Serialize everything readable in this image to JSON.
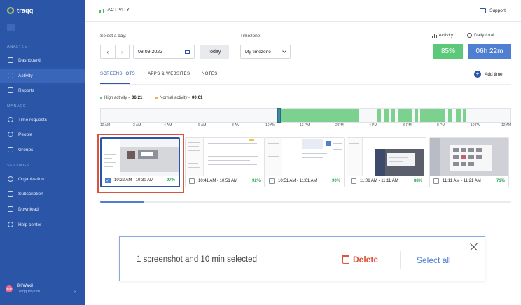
{
  "app": {
    "name": "traqq"
  },
  "sidebar": {
    "sections": [
      {
        "label": "ANALYZE",
        "items": [
          {
            "label": "Dashboard",
            "icon": "monitor-icon"
          },
          {
            "label": "Activity",
            "icon": "home-icon",
            "active": true
          },
          {
            "label": "Reports",
            "icon": "folder-icon"
          }
        ]
      },
      {
        "label": "MANAGE",
        "items": [
          {
            "label": "Time requests",
            "icon": "clock-icon"
          },
          {
            "label": "People",
            "icon": "people-icon"
          },
          {
            "label": "Groups",
            "icon": "group-icon"
          }
        ]
      },
      {
        "label": "SETTINGS",
        "items": [
          {
            "label": "Organization",
            "icon": "gear-icon"
          },
          {
            "label": "Subscription",
            "icon": "star-icon"
          },
          {
            "label": "Download",
            "icon": "download-icon"
          },
          {
            "label": "Help center",
            "icon": "help-icon"
          }
        ]
      }
    ],
    "user": {
      "initials": "BW",
      "name": "Bil Wakil",
      "org": "Traqq Pty Ltd"
    }
  },
  "header": {
    "title": "ACTIVITY",
    "support_label": "Support"
  },
  "filters": {
    "day_label": "Select a day:",
    "date_value": "08.09.2022",
    "today_label": "Today",
    "timezone_label": "Timezone:",
    "timezone_value": "My timezone"
  },
  "stats": {
    "activity_label": "Activity:",
    "activity_value": "85%",
    "daily_total_label": "Daily total:",
    "daily_total_value": "06h 22m",
    "activity_color": "#5cc97a",
    "total_color": "#4f7fd1"
  },
  "tabs": [
    {
      "label": "SCREENSHOTS",
      "active": true
    },
    {
      "label": "APPS & WEBSITES",
      "active": false
    },
    {
      "label": "NOTES",
      "active": false
    }
  ],
  "add_time_label": "Add time",
  "legend": {
    "high_label": "High activity -",
    "high_value": "06:21",
    "normal_label": "Normal activity -",
    "normal_value": "00:01",
    "high_color": "#5cc97a",
    "normal_color": "#f3b33d"
  },
  "timeline": {
    "ticks": [
      "12 AM",
      "2 AM",
      "4 AM",
      "6 AM",
      "8 AM",
      "10 AM",
      "12 PM",
      "2 PM",
      "4 PM",
      "6 PM",
      "8 PM",
      "10 PM",
      "12 AM"
    ]
  },
  "screenshots": [
    {
      "time": "10:22 AM - 10:30 AM",
      "percent": "97%",
      "checked": true
    },
    {
      "time": "10:41 AM - 10:51 AM",
      "percent": "92%",
      "checked": false
    },
    {
      "time": "10:51 AM - 11:01 AM",
      "percent": "90%",
      "checked": false
    },
    {
      "time": "11:01 AM - 11:11 AM",
      "percent": "88%",
      "checked": false
    },
    {
      "time": "11:11 AM - 11:21 AM",
      "percent": "71%",
      "checked": false
    }
  ],
  "selection": {
    "summary": "1 screenshot and 10 min selected",
    "delete_label": "Delete",
    "select_all_label": "Select all"
  }
}
